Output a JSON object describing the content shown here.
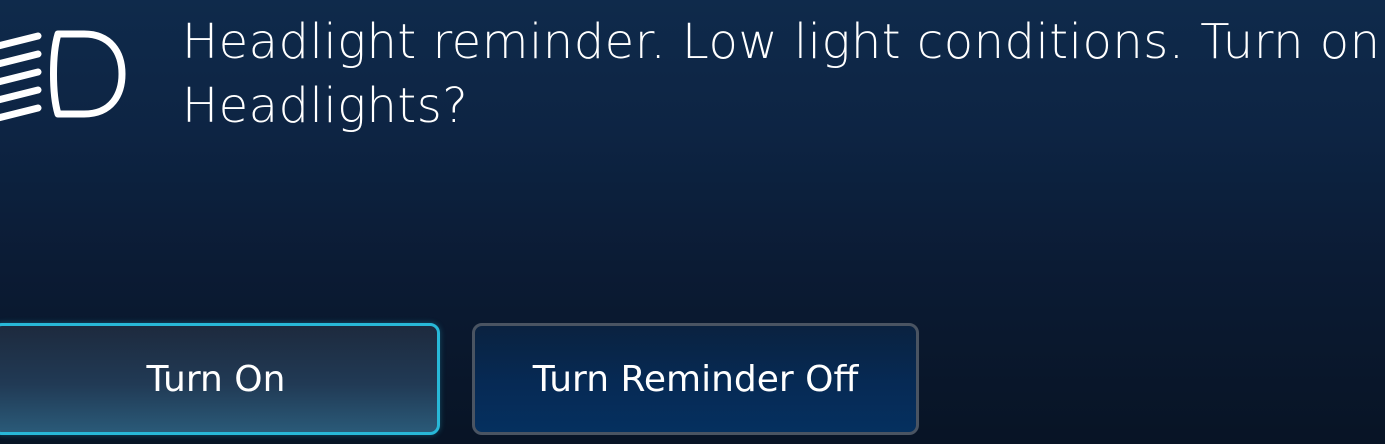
{
  "alert": {
    "icon": "headlight-icon",
    "message": "Headlight reminder. Low light conditions. Turn on Headlights?"
  },
  "buttons": {
    "turn_on_label": "Turn On",
    "reminder_off_label": "Turn Reminder Off"
  },
  "colors": {
    "accent_border": "#28b8d8",
    "background_top": "#0f2a4b",
    "background_bottom": "#081425"
  }
}
